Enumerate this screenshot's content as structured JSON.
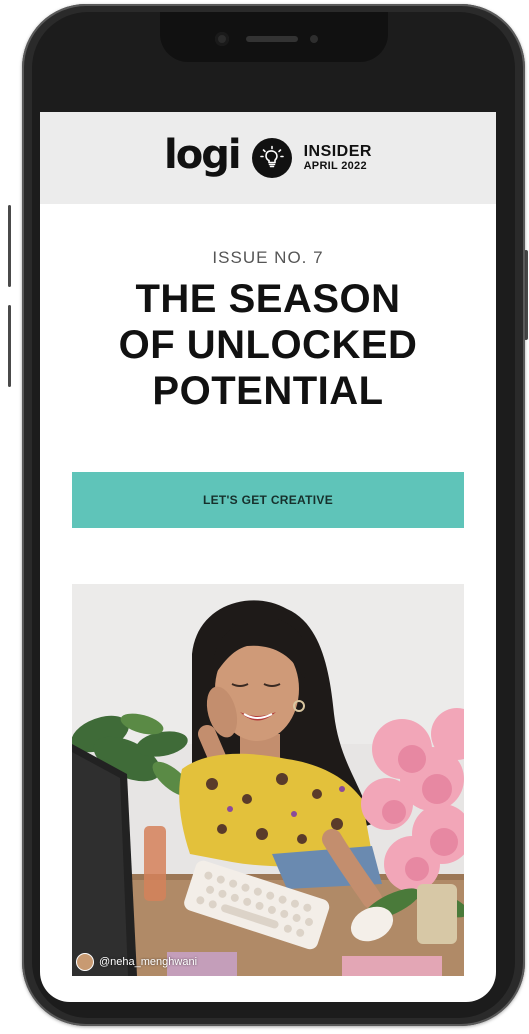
{
  "device": {
    "frame_color": "#2a2a2a",
    "bezel_color": "#1c1c1c"
  },
  "email": {
    "header": {
      "logo_text": "logi",
      "badge_icon": "lightbulb-icon",
      "program_label": "INSIDER",
      "issue_date": "APRIL 2022",
      "background": "#ececec"
    },
    "issue_label": "ISSUE NO. 7",
    "headline_lines": [
      "THE SEASON",
      "OF UNLOCKED",
      "POTENTIAL"
    ],
    "cta": {
      "label": "LET'S GET CREATIVE",
      "color": "#5fc4b9"
    },
    "hero": {
      "alt_description": "",
      "photo_credit": "@neha_menghwani"
    }
  }
}
